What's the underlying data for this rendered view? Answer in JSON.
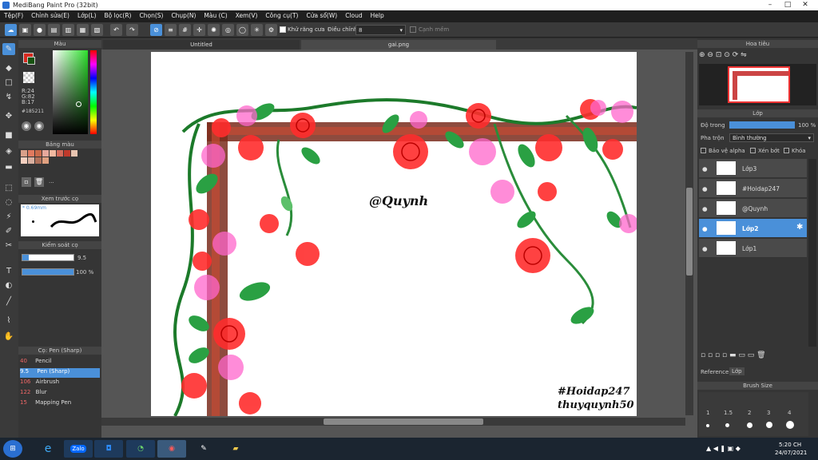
{
  "window": {
    "title": "MediBang Paint Pro (32bit)",
    "min": "–",
    "max": "□",
    "close": "✕"
  },
  "menu": [
    "Tệp(F)",
    "Chỉnh sửa(E)",
    "Lớp(L)",
    "Bộ lọc(R)",
    "Chọn(S)",
    "Chụp(N)",
    "Màu (C)",
    "Xem(V)",
    "Công cụ(T)",
    "Cửa sổ(W)",
    "Cloud",
    "Help"
  ],
  "toolbar": {
    "antialias_label": "Khử răng cưa",
    "adjust_label": "Điều chỉnh",
    "adjust_value": "8",
    "snap_label": "Cạnh mềm"
  },
  "color_panel": {
    "title": "Màu",
    "rgb_r": "R:24",
    "rgb_g": "G:82",
    "rgb_b": "B:17",
    "hex": "#185211",
    "main_color": "#185211",
    "sub_color": "#d62a1f"
  },
  "palette_panel": {
    "title": "Bảng màu",
    "more": "..."
  },
  "preview_panel": {
    "title": "Xem trước cọ",
    "size": "* 0.69mm"
  },
  "brush_control": {
    "title": "Kiểm soát cọ",
    "size_value": "9.5",
    "opacity_value": "100 %"
  },
  "brush_list": {
    "title": "Cọ: Pen (Sharp)",
    "items": [
      {
        "size": "40",
        "name": "Pencil"
      },
      {
        "size": "9.5",
        "name": "Pen (Sharp)"
      },
      {
        "size": "106",
        "name": "Airbrush"
      },
      {
        "size": "122",
        "name": "Blur"
      },
      {
        "size": "15",
        "name": "Mapping Pen"
      }
    ]
  },
  "canvas": {
    "tab1": "Untitled",
    "tab2": "gai.png",
    "text1": "@Quynh",
    "text2": "#Hoidap247",
    "text3": "thuyquynh50"
  },
  "navigator": {
    "title": "Hoa tiêu"
  },
  "layer_panel": {
    "title": "Lớp",
    "opacity_label": "Độ trong",
    "opacity_value": "100 %",
    "blend_label": "Pha trộn",
    "blend_value": "Bình thường",
    "protect_alpha": "Bảo vệ alpha",
    "clipping": "Xén bớt",
    "lock": "Khóa",
    "layers": [
      {
        "name": "Lớp3"
      },
      {
        "name": "#Hoidap247"
      },
      {
        "name": "@Quynh"
      },
      {
        "name": "Lớp2"
      },
      {
        "name": "Lớp1"
      }
    ]
  },
  "bottom_tabs": {
    "reference": "Reference",
    "layer": "Lớp"
  },
  "brush_size": {
    "title": "Brush Size",
    "values": [
      "1",
      "1.5",
      "2",
      "3",
      "4"
    ]
  },
  "taskbar": {
    "time": "5:20 CH",
    "date": "24/07/2021",
    "zalo": "Zalo"
  }
}
